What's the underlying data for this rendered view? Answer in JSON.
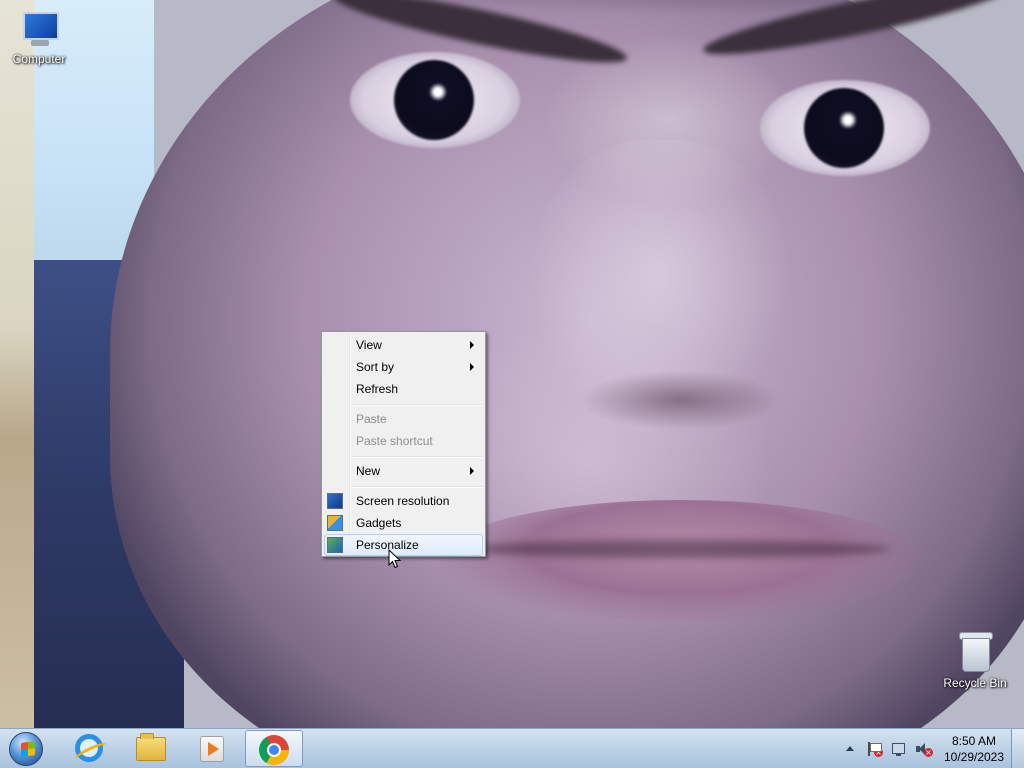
{
  "desktop": {
    "icons": [
      {
        "label": "Computer"
      },
      {
        "label": "Recycle Bin"
      }
    ]
  },
  "context_menu": {
    "items": [
      {
        "label": "View",
        "has_submenu": true,
        "enabled": true
      },
      {
        "label": "Sort by",
        "has_submenu": true,
        "enabled": true
      },
      {
        "label": "Refresh",
        "has_submenu": false,
        "enabled": true
      },
      {
        "label": "Paste",
        "has_submenu": false,
        "enabled": false
      },
      {
        "label": "Paste shortcut",
        "has_submenu": false,
        "enabled": false
      },
      {
        "label": "New",
        "has_submenu": true,
        "enabled": true
      },
      {
        "label": "Screen resolution",
        "icon": "screen-resolution-icon",
        "enabled": true
      },
      {
        "label": "Gadgets",
        "icon": "gadgets-icon",
        "enabled": true
      },
      {
        "label": "Personalize",
        "icon": "personalize-icon",
        "enabled": true,
        "highlighted": true
      }
    ]
  },
  "taskbar": {
    "pinned": [
      {
        "icon": "internet-explorer-icon"
      },
      {
        "icon": "windows-explorer-icon"
      },
      {
        "icon": "media-player-icon"
      },
      {
        "icon": "chrome-icon",
        "active": true
      }
    ],
    "tray": {
      "icons": [
        "show-hidden-icons-arrow",
        "action-center-flag-icon",
        "network-icon",
        "volume-muted-icon"
      ],
      "time": "8:50 AM",
      "date": "10/29/2023"
    }
  },
  "colors": {
    "menu_background": "#f0f0f0",
    "menu_highlight": "#dcebfc",
    "disabled_text": "#8d8d8d",
    "taskbar": "#bfd3e8"
  }
}
